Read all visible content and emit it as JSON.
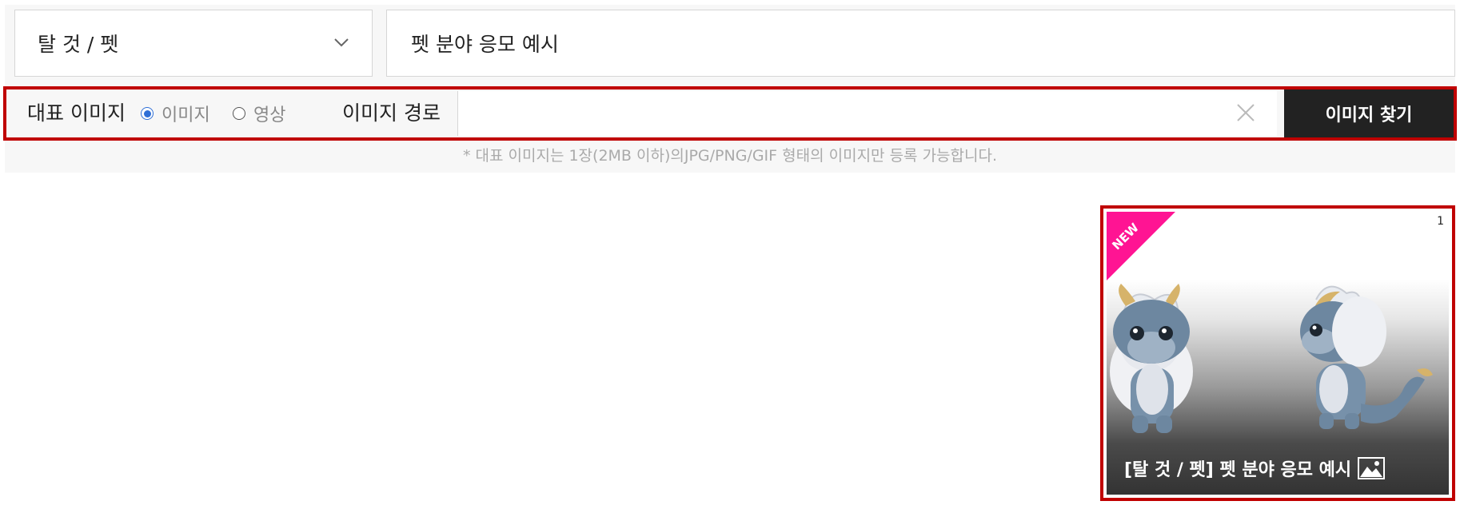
{
  "form": {
    "category": {
      "selected": "탈 것 / 펫"
    },
    "title_value": "펫 분야 응모 예시",
    "image_row": {
      "label": "대표 이미지",
      "radio_image": "이미지",
      "radio_video": "영상",
      "path_label": "이미지 경로",
      "path_value": "",
      "find_button": "이미지 찾기"
    },
    "notice": "* 대표 이미지는 1장(2MB 이하)의JPG/PNG/GIF 형태의 이미지만 등록 가능합니다."
  },
  "preview_card": {
    "ribbon": "NEW",
    "index": "1",
    "caption": "[탈 것 / 펫] 펫 분야 응모 예시"
  },
  "colors": {
    "highlight": "#c00000",
    "ribbon": "#ff1493",
    "button": "#222222",
    "radio": "#2f6fd6"
  },
  "icons": [
    "chevron-down-icon",
    "close-icon",
    "image-icon"
  ]
}
